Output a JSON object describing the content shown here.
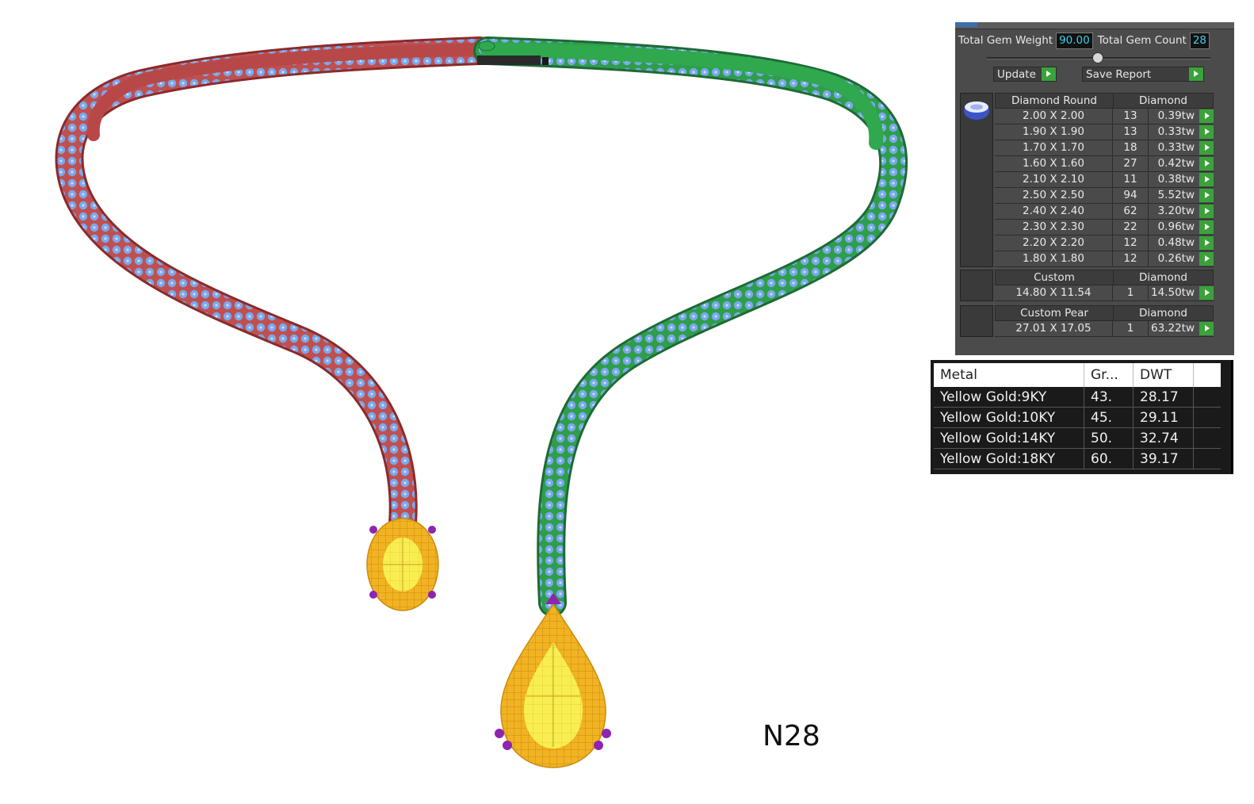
{
  "viewport": {
    "label": "N28",
    "colors": {
      "left_band": "#b84848",
      "right_band": "#2fa84e",
      "diamond": "#7aa8ec",
      "gold": "#f0b020",
      "gold_center": "#f8ee50",
      "prong": "#8e24b0"
    }
  },
  "gem_panel": {
    "total_weight_label": "Total Gem Weight",
    "total_weight_value": "90.00",
    "total_count_label": "Total Gem Count",
    "total_count_value": "28",
    "update_label": "Update",
    "save_report_label": "Save Report",
    "groups": [
      {
        "shape": "Diamond Round",
        "material": "Diamond",
        "rows": [
          {
            "size": "2.00 X 2.00",
            "count": "13",
            "weight": "0.39tw"
          },
          {
            "size": "1.90 X 1.90",
            "count": "13",
            "weight": "0.33tw"
          },
          {
            "size": "1.70 X 1.70",
            "count": "18",
            "weight": "0.33tw"
          },
          {
            "size": "1.60 X 1.60",
            "count": "27",
            "weight": "0.42tw"
          },
          {
            "size": "2.10 X 2.10",
            "count": "11",
            "weight": "0.38tw"
          },
          {
            "size": "2.50 X 2.50",
            "count": "94",
            "weight": "5.52tw"
          },
          {
            "size": "2.40 X 2.40",
            "count": "62",
            "weight": "3.20tw"
          },
          {
            "size": "2.30 X 2.30",
            "count": "22",
            "weight": "0.96tw"
          },
          {
            "size": "2.20 X 2.20",
            "count": "12",
            "weight": "0.48tw"
          },
          {
            "size": "1.80 X 1.80",
            "count": "12",
            "weight": "0.26tw"
          }
        ]
      },
      {
        "shape": "Custom",
        "material": "Diamond",
        "rows": [
          {
            "size": "14.80 X 11.54",
            "count": "1",
            "weight": "14.50tw"
          }
        ]
      },
      {
        "shape": "Custom Pear",
        "material": "Diamond",
        "rows": [
          {
            "size": "27.01 X 17.05",
            "count": "1",
            "weight": "63.22tw"
          }
        ]
      }
    ]
  },
  "metal_table": {
    "headers": [
      "Metal",
      "Gr...",
      "DWT"
    ],
    "rows": [
      {
        "metal": "Yellow Gold:9KY",
        "grams": "43.",
        "dwt": "28.17"
      },
      {
        "metal": "Yellow Gold:10KY",
        "grams": "45.",
        "dwt": "29.11"
      },
      {
        "metal": "Yellow Gold:14KY",
        "grams": "50.",
        "dwt": "32.74"
      },
      {
        "metal": "Yellow Gold:18KY",
        "grams": "60.",
        "dwt": "39.17"
      }
    ]
  }
}
